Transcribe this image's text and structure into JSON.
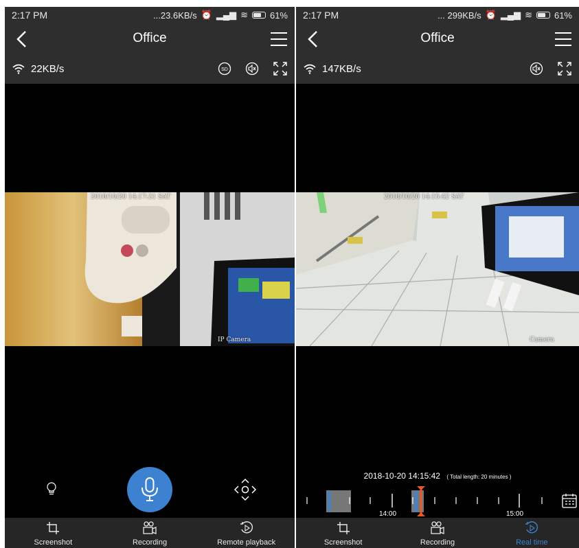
{
  "left": {
    "status": {
      "time": "2:17 PM",
      "net": "...23.6KB/s",
      "battery": "61%"
    },
    "title": "Office",
    "speed": "22KB/s",
    "video": {
      "timestamp": "2018/10/20 14:17:21 SAT",
      "label": "IP Camera"
    },
    "tabs": [
      {
        "label": "Screenshot",
        "icon": "crop-icon"
      },
      {
        "label": "Recording",
        "icon": "camera-recorder-icon"
      },
      {
        "label": "Remote playback",
        "icon": "playback-icon"
      }
    ]
  },
  "right": {
    "status": {
      "time": "2:17 PM",
      "net": "... 299KB/s",
      "battery": "61%"
    },
    "title": "Office",
    "speed": "147KB/s",
    "video": {
      "timestamp": "2018/10/20 14:15:42 SAT",
      "label": "Camera"
    },
    "timeline": {
      "current": "2018-10-20 14:15:42",
      "total": "( Total length: 20 minutes )",
      "tick_labels": [
        "14:00",
        "15:00"
      ]
    },
    "tabs": [
      {
        "label": "Screenshot",
        "icon": "crop-icon"
      },
      {
        "label": "Recording",
        "icon": "camera-recorder-icon"
      },
      {
        "label": "Real time",
        "icon": "playback-icon"
      }
    ]
  },
  "colors": {
    "accent": "#3d82d0",
    "bar": "#2e2e2e",
    "marker": "#e85a2a"
  }
}
